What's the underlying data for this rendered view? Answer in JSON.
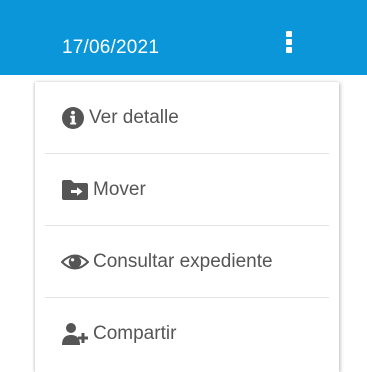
{
  "header": {
    "date": "17/06/2021",
    "background_color": "#0a96d8",
    "more_icon": "kebab-vertical-icon"
  },
  "menu": {
    "items": [
      {
        "label": "Ver detalle",
        "icon": "info-circle-icon"
      },
      {
        "label": "Mover",
        "icon": "folder-move-icon"
      },
      {
        "label": "Consultar expediente",
        "icon": "eye-icon"
      },
      {
        "label": "Compartir",
        "icon": "user-add-icon"
      }
    ],
    "text_color": "#555555",
    "icon_color": "#555555"
  }
}
